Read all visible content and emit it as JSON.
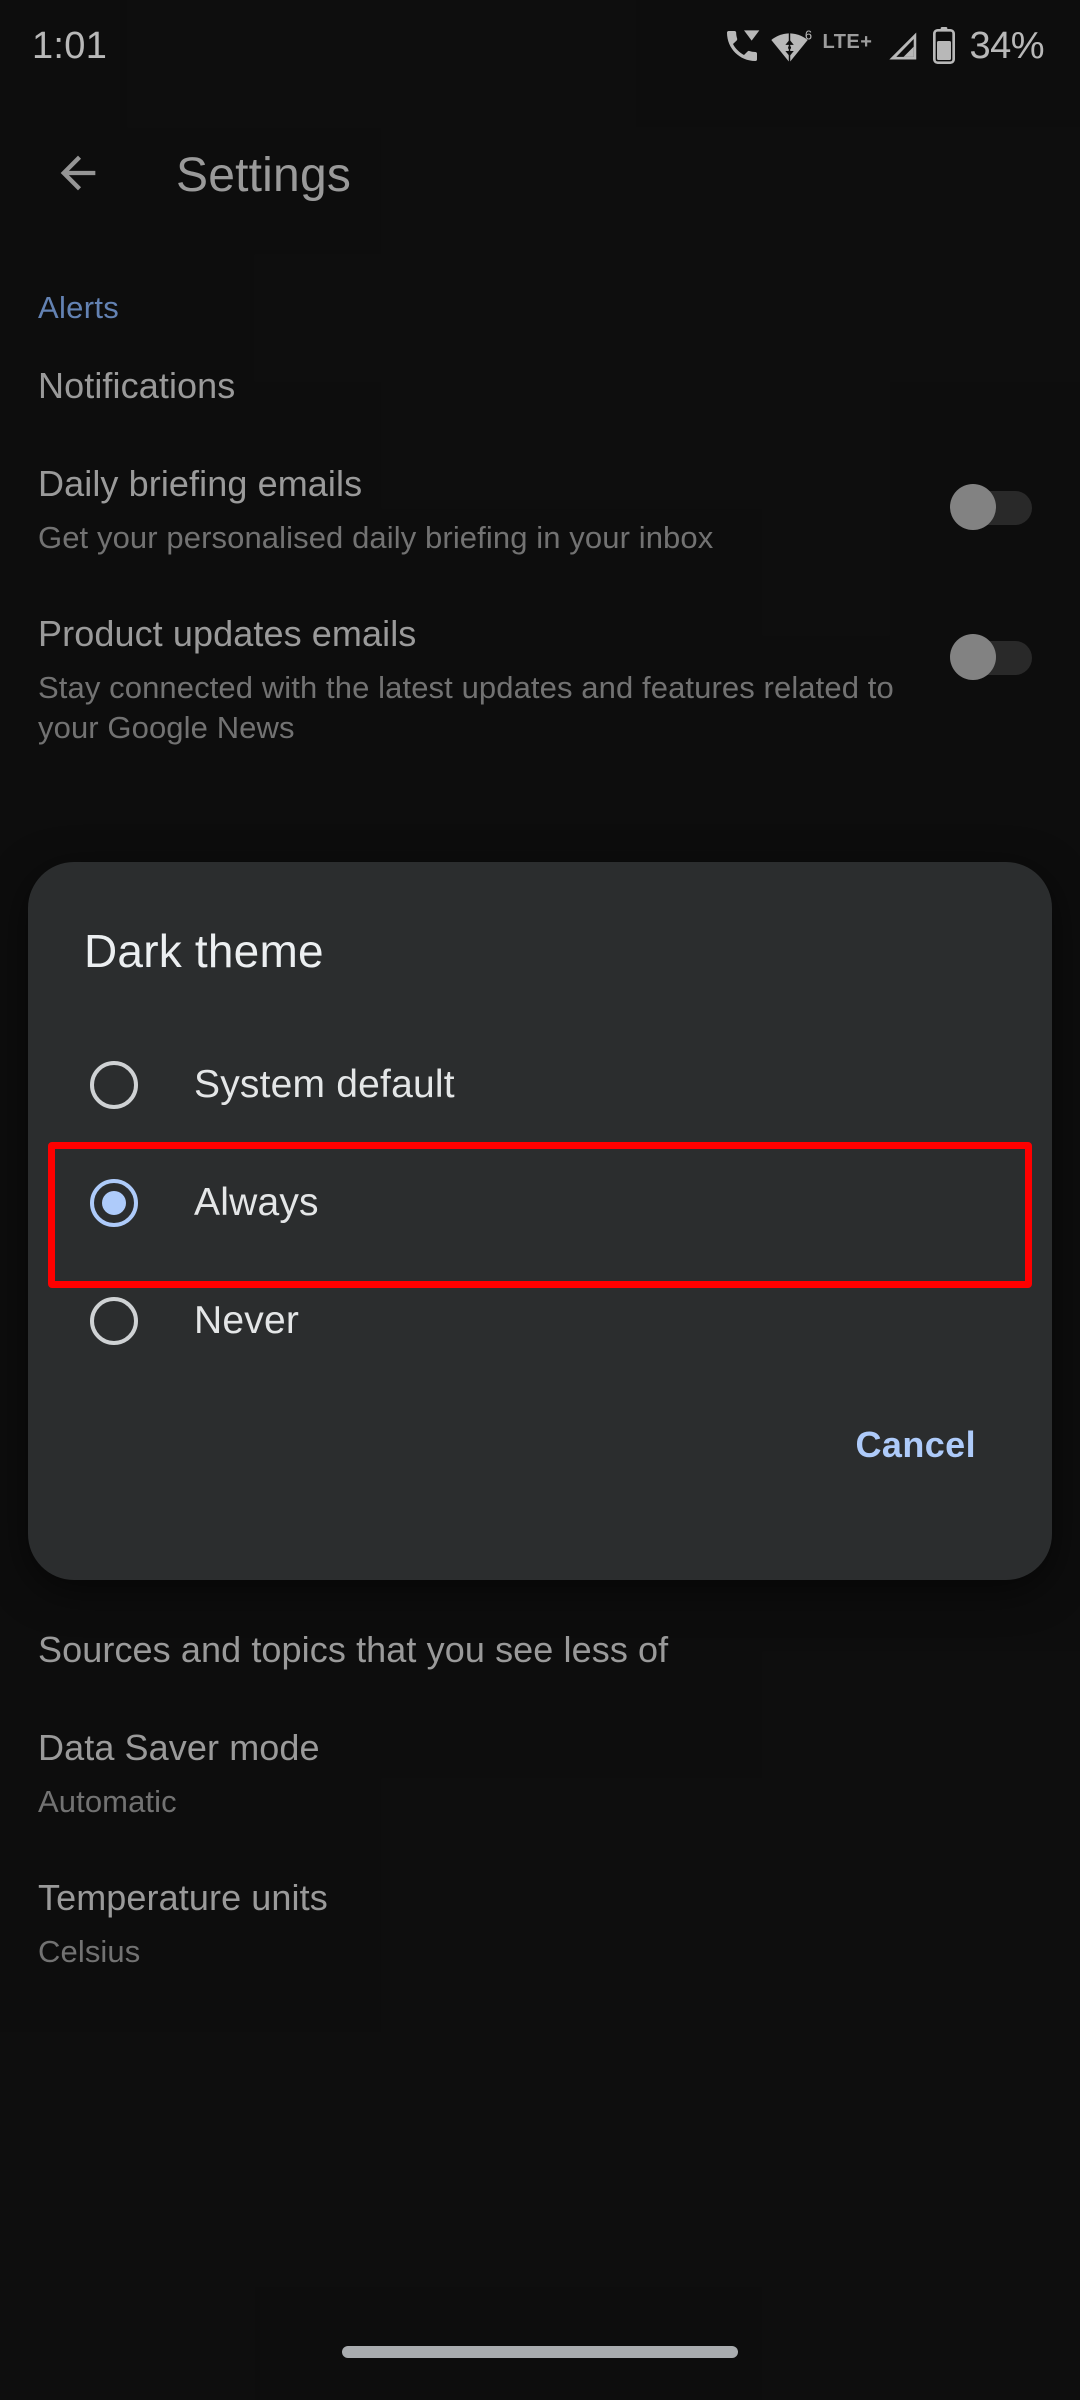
{
  "colors": {
    "background": "#131313",
    "dialog_surface": "#2b2d2e",
    "accent": "#aecbfa",
    "section_header": "#8ab4f8",
    "primary_text": "#d6d6d6",
    "secondary_text": "#9e9e9e",
    "highlight_outline": "#ff0000"
  },
  "status_bar": {
    "clock": "1:01",
    "network_label": "LTE+",
    "battery_percent": "34%",
    "icons": [
      "phone-wifi-calling-icon",
      "wifi-data-transfer-icon",
      "cell-signal-icon",
      "battery-icon"
    ]
  },
  "app_bar": {
    "back_icon": "arrow-back-icon",
    "title": "Settings"
  },
  "settings": {
    "section_header": "Alerts",
    "items": [
      {
        "name": "notifications",
        "title": "Notifications",
        "summary": "",
        "has_switch": false
      },
      {
        "name": "daily-briefing-emails",
        "title": "Daily briefing emails",
        "summary": "Get your personalised daily briefing in your inbox",
        "has_switch": true,
        "switch_state": "off"
      },
      {
        "name": "product-updates-emails",
        "title": "Product updates emails",
        "summary": "Stay connected with the latest updates and features related to your Google News",
        "has_switch": true,
        "switch_state": "off"
      }
    ],
    "lower_items": [
      {
        "name": "hidden-sources-and-topics",
        "title": "Sources and topics that you see less of",
        "summary": ""
      },
      {
        "name": "data-saver-mode",
        "title": "Data Saver mode",
        "summary": "Automatic"
      },
      {
        "name": "temperature-units",
        "title": "Temperature units",
        "summary": "Celsius"
      }
    ]
  },
  "dialog": {
    "title": "Dark theme",
    "options": [
      {
        "label": "System default",
        "selected": false
      },
      {
        "label": "Always",
        "selected": true
      },
      {
        "label": "Never",
        "selected": false
      }
    ],
    "cancel_label": "Cancel",
    "highlighted_option": "Always"
  },
  "nav_bar": {
    "gesture_pill": "home-gesture-pill"
  }
}
